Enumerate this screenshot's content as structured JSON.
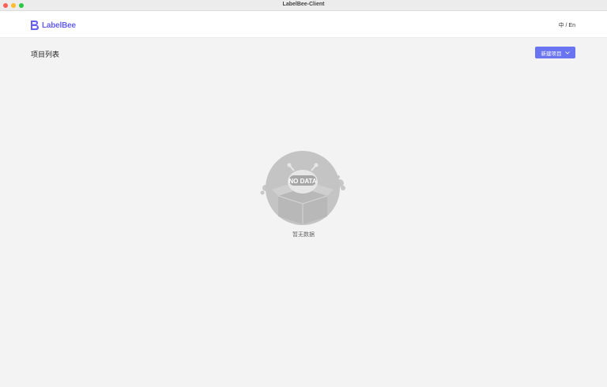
{
  "window": {
    "title": "LabelBee-Client"
  },
  "header": {
    "logo_text": "LabelBee",
    "lang_toggle": "中 / En"
  },
  "main": {
    "page_title": "项目列表",
    "new_project_label": "新建项目",
    "empty": {
      "badge_text": "NO DATA",
      "message": "暂无数据"
    }
  },
  "colors": {
    "brand": "#6661f0",
    "button": "#6b74f0",
    "background": "#f3f3f3"
  }
}
